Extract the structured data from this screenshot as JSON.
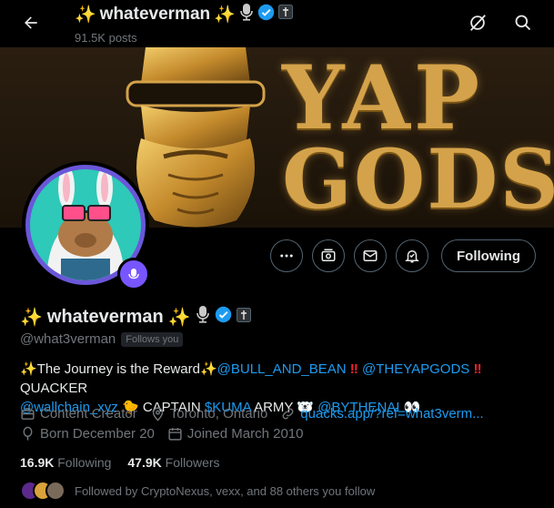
{
  "header": {
    "title": "whateverman",
    "post_count": "91.5K posts"
  },
  "banner": {
    "line1": "YAP",
    "line2": "GODS"
  },
  "profile": {
    "name": "whateverman",
    "handle": "@what3verman",
    "follows_you": "Follows you",
    "following_button": "Following"
  },
  "bio": {
    "intro": "The Journey is the Reward",
    "mention1": "@BULL_AND_BEAN",
    "mention2": "@THEYAPGODS",
    "quacker": "QUACKER",
    "mention3": "@wallchain_xyz",
    "captain": "CAPTAIN",
    "cashtag": "$KUMA",
    "army": "ARMY",
    "mention4": "@BYTHENAI"
  },
  "meta": {
    "category": "Content Creator",
    "location": "Toronto, Ontario",
    "website": "quacks.app/?ref=what3verm...",
    "born": "Born December 20",
    "joined": "Joined March 2010"
  },
  "stats": {
    "following_count": "16.9K",
    "following_label": "Following",
    "followers_count": "47.9K",
    "followers_label": "Followers"
  },
  "followed_by": {
    "text": "Followed by CryptoNexus, vexx, and 88 others you follow"
  },
  "colors": {
    "accent": "#1d9bf0",
    "background": "#000000",
    "muted": "#71767b",
    "avatar_ring": "#6a57d9",
    "banner_gold": "#d4a24a"
  }
}
